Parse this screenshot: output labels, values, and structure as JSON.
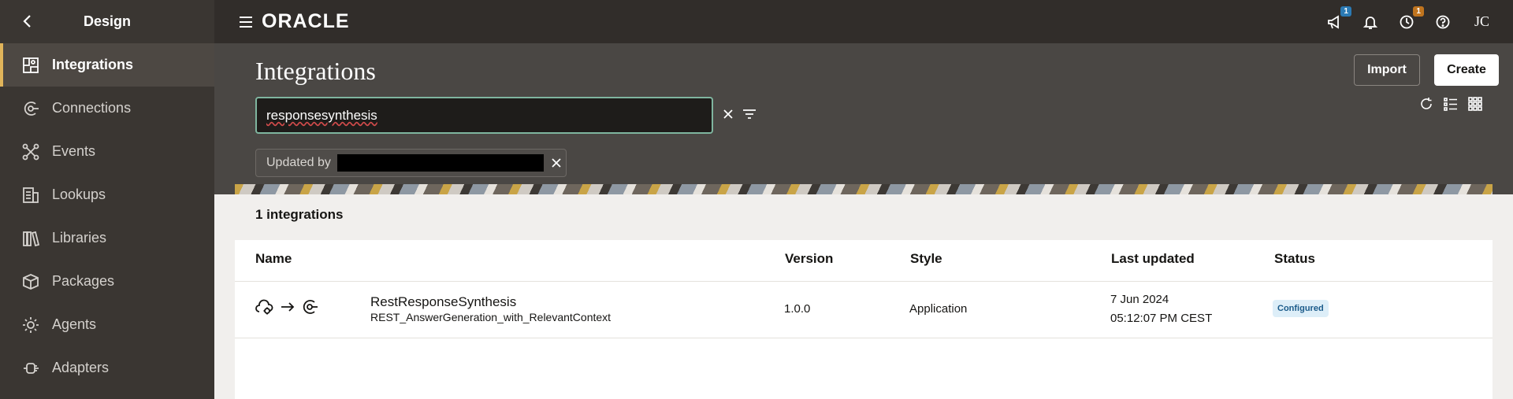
{
  "sidebar": {
    "title": "Design",
    "items": [
      {
        "label": "Integrations",
        "icon": "integrations-icon",
        "active": true
      },
      {
        "label": "Connections",
        "icon": "connections-icon"
      },
      {
        "label": "Events",
        "icon": "events-icon"
      },
      {
        "label": "Lookups",
        "icon": "lookups-icon"
      },
      {
        "label": "Libraries",
        "icon": "libraries-icon"
      },
      {
        "label": "Packages",
        "icon": "packages-icon"
      },
      {
        "label": "Agents",
        "icon": "agents-icon"
      },
      {
        "label": "Adapters",
        "icon": "adapters-icon"
      }
    ]
  },
  "topbar": {
    "logo": "ORACLE",
    "announcements_badge": "1",
    "activity_badge": "1",
    "user_initials": "JC"
  },
  "header": {
    "title": "Integrations",
    "import_label": "Import",
    "create_label": "Create",
    "search_value": "responsesynthesis",
    "filter_chip_label": "Updated by"
  },
  "content": {
    "count_label": "1 integrations",
    "columns": {
      "name": "Name",
      "version": "Version",
      "style": "Style",
      "last_updated": "Last updated",
      "status": "Status"
    },
    "rows": [
      {
        "name": "RestResponseSynthesis",
        "identifier": "REST_AnswerGeneration_with_RelevantContext",
        "version": "1.0.0",
        "style": "Application",
        "date": "7 Jun 2024",
        "time": "05:12:07 PM CEST",
        "status": "Configured"
      }
    ]
  },
  "colors": {
    "sidebar_bg": "#3a3632",
    "topbar_bg": "#312d2a",
    "header_bg": "#4a4744",
    "active_accent": "#e0b45a",
    "search_border": "#7fb59f",
    "status_bg": "#ddeef8",
    "status_text": "#1b5b8a"
  }
}
